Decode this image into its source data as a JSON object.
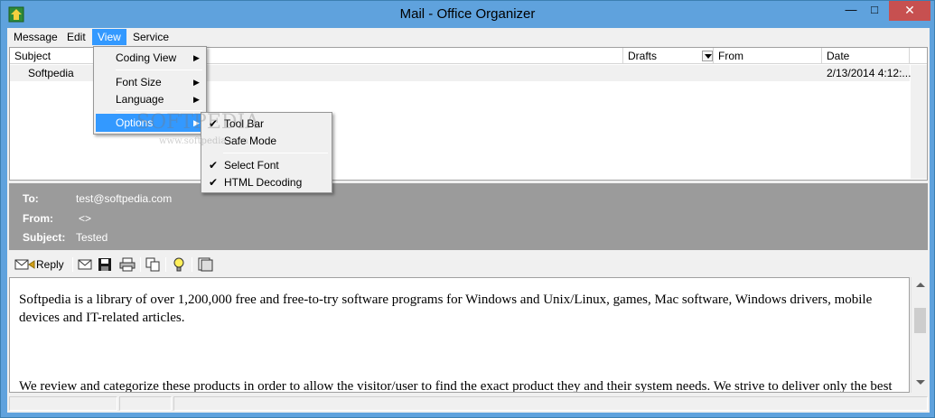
{
  "window": {
    "title": "Mail - Office Organizer",
    "min_glyph": "—",
    "max_glyph": "□",
    "close_glyph": "✕"
  },
  "menubar": {
    "items": [
      "Message",
      "Edit",
      "View",
      "Service"
    ]
  },
  "list": {
    "columns": [
      "Subject",
      "Drafts",
      "From",
      "Date"
    ],
    "rows": [
      {
        "subject": "Softpedia",
        "from": "",
        "date": "2/13/2014 4:12:..."
      }
    ]
  },
  "view_menu": {
    "items": [
      "Coding View",
      "Font Size",
      "Language",
      "Options"
    ],
    "submenu_arrow": "▶"
  },
  "options_menu": {
    "items": [
      {
        "label": "Tool Bar",
        "checked": true
      },
      {
        "label": "Safe Mode",
        "checked": false
      },
      {
        "label": "Select Font",
        "checked": true
      },
      {
        "label": "HTML Decoding",
        "checked": true
      }
    ],
    "check_glyph": "✔"
  },
  "header": {
    "to_label": "To:",
    "to_value": "test@softpedia.com",
    "from_label": "From:",
    "from_value": "<>",
    "subject_label": "Subject:",
    "subject_value": "Tested"
  },
  "toolbar": {
    "reply_label": "Reply"
  },
  "body": {
    "para1": "Softpedia is a library of over 1,200,000 free and free-to-try software programs for Windows and Unix/Linux, games, Mac software, Windows drivers, mobile devices and IT-related articles.",
    "para2": "We review and categorize these products in order to allow the visitor/user to find the exact product they and their system needs. We strive to deliver only the best"
  },
  "watermark": {
    "text": "SOFTPEDIA",
    "url": "www.softpedia.com"
  },
  "colors": {
    "titlebar": "#5fa2dd",
    "close": "#c75050",
    "highlight": "#3399ff",
    "header_panel": "#9b9b9b"
  }
}
